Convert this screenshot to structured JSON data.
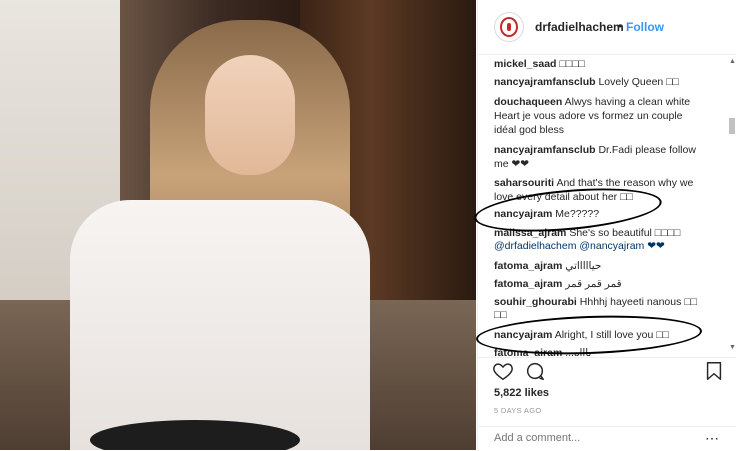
{
  "header": {
    "username": "drfadielhachem",
    "bullet": "•",
    "follow": "Follow"
  },
  "comments": [
    {
      "user": "mickel_saad",
      "text": "□□□□"
    },
    {
      "user": "nancyajramfansclub",
      "text": "Lovely Queen □□"
    },
    {
      "user": "douchaqueen",
      "text": "Alwys having a clean white"
    },
    {
      "user": "",
      "text": "Heart je vous adore vs formez un couple"
    },
    {
      "user": "",
      "text": "idéal god bless"
    },
    {
      "user": "nancyajramfansclub",
      "text": "Dr.Fadi please follow"
    },
    {
      "user": "",
      "text": "me ❤❤"
    },
    {
      "user": "saharsouriti",
      "text": "And that's the reason why we"
    },
    {
      "user": "",
      "text": "love every detail about her □□"
    },
    {
      "user": "nancyajram",
      "text": "Me?????"
    },
    {
      "user": "mallssa_ajram",
      "text": "She's so beautiful □□□□"
    },
    {
      "user": "",
      "text": "@drfadielhachem @nancyajram ❤❤"
    },
    {
      "user": "fatoma_ajram",
      "text": "حياااااتي"
    },
    {
      "user": "fatoma_ajram",
      "text": "قمر قمر قمر"
    },
    {
      "user": "souhir_ghourabi",
      "text": "Hhhhj hayeeti nanous □□"
    },
    {
      "user": "",
      "text": "□□"
    },
    {
      "user": "nancyajram",
      "text": "Alright, I still love you □□"
    },
    {
      "user": "fatoma_ajram",
      "text": "...ياااه"
    }
  ],
  "icons": [
    "heart-icon",
    "comment-icon",
    "bookmark-icon",
    "more-icon"
  ],
  "likes": "5,822 likes",
  "date": "5 DAYS AGO",
  "add_comment": {
    "placeholder": "Add a comment..."
  },
  "colors": {
    "accent": "#3897f0",
    "text": "#262626",
    "muted": "#999999"
  }
}
